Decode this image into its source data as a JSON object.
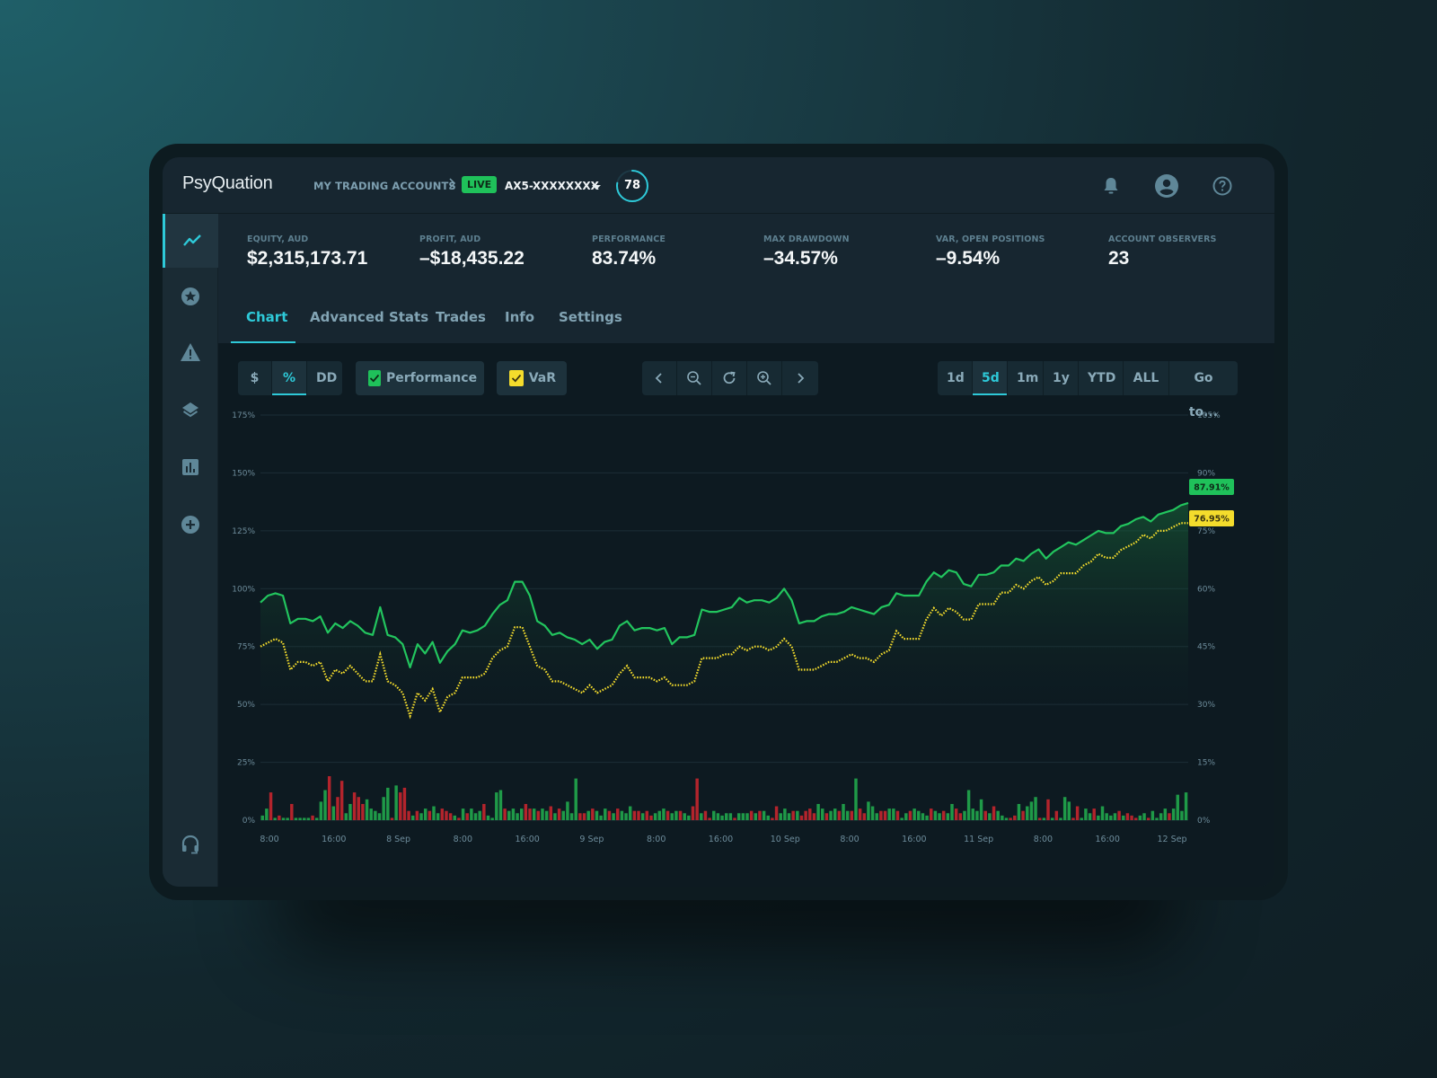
{
  "app": {
    "logo": "PsyQuation",
    "breadcrumb": "MY TRADING ACCOUNTS",
    "status_badge": "LIVE",
    "account": "AX5-XXXXXXXX",
    "score": "78",
    "score_fraction": 0.78
  },
  "sidebar": {
    "items": [
      {
        "icon": "trend-line-icon",
        "active": true
      },
      {
        "icon": "star-circle-icon",
        "active": false
      },
      {
        "icon": "warning-icon",
        "active": false
      },
      {
        "icon": "layers-icon",
        "active": false
      },
      {
        "icon": "bar-chart-icon",
        "active": false
      },
      {
        "icon": "plus-circle-icon",
        "active": false
      },
      {
        "icon": "headset-icon",
        "active": false
      }
    ]
  },
  "header_icons": [
    "bell-icon",
    "user-avatar-icon",
    "help-icon"
  ],
  "stats": [
    {
      "label": "EQUITY, AUD",
      "value": "$2,315,173.71"
    },
    {
      "label": "PROFIT, AUD",
      "value": "–$18,435.22"
    },
    {
      "label": "PERFORMANCE",
      "value": "83.74%"
    },
    {
      "label": "MAX DRAWDOWN",
      "value": "–34.57%"
    },
    {
      "label": "VAR, OPEN POSITIONS",
      "value": "–9.54%"
    },
    {
      "label": "ACCOUNT OBSERVERS",
      "value": "23"
    }
  ],
  "tabs": [
    {
      "label": "Chart",
      "active": true
    },
    {
      "label": "Advanced Stats",
      "active": false
    },
    {
      "label": "Trades",
      "active": false
    },
    {
      "label": "Info",
      "active": false
    },
    {
      "label": "Settings",
      "active": false
    }
  ],
  "toolbar": {
    "units": [
      {
        "label": "$",
        "active": false
      },
      {
        "label": "%",
        "active": true
      },
      {
        "label": "DD",
        "active": false
      }
    ],
    "toggles": [
      {
        "label": "Performance",
        "checked": true,
        "color": "#1fc15a"
      },
      {
        "label": "VaR",
        "checked": true,
        "color": "#f4dc2c"
      }
    ],
    "nav": [
      "chevron-left-icon",
      "zoom-out-icon",
      "refresh-icon",
      "zoom-in-icon",
      "chevron-right-icon"
    ],
    "ranges": [
      {
        "label": "1d",
        "active": false
      },
      {
        "label": "5d",
        "active": true
      },
      {
        "label": "1m",
        "active": false
      },
      {
        "label": "1y",
        "active": false
      },
      {
        "label": "YTD",
        "active": false
      },
      {
        "label": "ALL",
        "active": false
      },
      {
        "label": "Go to...",
        "active": false
      }
    ]
  },
  "chart_data": {
    "type": "line",
    "left_axis": {
      "ticks": [
        "175%",
        "150%",
        "125%",
        "100%",
        "75%",
        "50%",
        "25%",
        "0%"
      ],
      "range": [
        0,
        175
      ]
    },
    "right_axis": {
      "ticks": [
        "105%",
        "90%",
        "75%",
        "60%",
        "45%",
        "30%",
        "15%",
        "0%"
      ],
      "range": [
        0,
        105
      ]
    },
    "x_ticks": [
      "8:00",
      "16:00",
      "8 Sep",
      "8:00",
      "16:00",
      "9 Sep",
      "8:00",
      "16:00",
      "10 Sep",
      "8:00",
      "16:00",
      "11 Sep",
      "8:00",
      "16:00",
      "12 Sep"
    ],
    "grid": true,
    "series": [
      {
        "name": "Performance",
        "axis": "left",
        "color": "#22c55e",
        "style": "solid",
        "last_label": "87.91%",
        "values": [
          94,
          97,
          98,
          97,
          85,
          87,
          87,
          86,
          88,
          81,
          85,
          83,
          86,
          84,
          81,
          80,
          92,
          80,
          79,
          76,
          66,
          76,
          72,
          77,
          68,
          73,
          76,
          82,
          81,
          82,
          84,
          89,
          93,
          95,
          103,
          103,
          97,
          86,
          84,
          80,
          81,
          79,
          78,
          76,
          78,
          74,
          77,
          78,
          84,
          86,
          82,
          83,
          83,
          82,
          83,
          76,
          79,
          79,
          80,
          91,
          90,
          90,
          91,
          92,
          96,
          94,
          95,
          95,
          94,
          96,
          100,
          95,
          85,
          86,
          86,
          88,
          89,
          89,
          90,
          92,
          91,
          90,
          89,
          92,
          93,
          98,
          97,
          97,
          97,
          103,
          107,
          105,
          108,
          107,
          102,
          101,
          106,
          106,
          107,
          110,
          110,
          113,
          112,
          115,
          117,
          113,
          116,
          118,
          120,
          119,
          121,
          123,
          125,
          124,
          124,
          127,
          128,
          130,
          131,
          129,
          132,
          133,
          134,
          136,
          137
        ]
      },
      {
        "name": "VaR",
        "axis": "right",
        "color": "#f4dc2c",
        "style": "dotted",
        "last_label": "76.95%",
        "values": [
          45,
          46,
          47,
          46,
          39,
          41,
          41,
          40,
          41,
          36,
          39,
          38,
          40,
          38,
          36,
          36,
          43,
          36,
          35,
          33,
          27,
          33,
          31,
          34,
          28,
          32,
          33,
          37,
          37,
          37,
          38,
          42,
          44,
          45,
          50,
          50,
          45,
          40,
          39,
          36,
          36,
          35,
          34,
          33,
          35,
          33,
          34,
          35,
          38,
          40,
          37,
          37,
          37,
          36,
          37,
          35,
          35,
          35,
          36,
          42,
          42,
          42,
          43,
          43,
          45,
          44,
          45,
          45,
          44,
          45,
          47,
          45,
          39,
          39,
          39,
          40,
          41,
          41,
          42,
          43,
          42,
          42,
          41,
          43,
          44,
          49,
          47,
          47,
          47,
          52,
          55,
          53,
          55,
          54,
          52,
          52,
          56,
          56,
          56,
          59,
          59,
          61,
          60,
          62,
          63,
          61,
          62,
          64,
          64,
          64,
          66,
          67,
          69,
          68,
          68,
          70,
          71,
          72,
          74,
          73,
          75,
          75,
          76,
          77,
          77
        ]
      }
    ],
    "volume": {
      "axis": "left",
      "values": [
        2,
        5,
        12,
        1,
        2,
        1,
        1,
        7,
        1,
        1,
        1,
        1,
        2,
        1,
        8,
        13,
        19,
        6,
        10,
        17,
        3,
        7,
        12,
        10,
        7,
        9,
        5,
        4,
        3,
        10,
        14,
        1,
        15,
        12,
        14,
        4,
        2,
        4,
        3,
        5,
        4,
        6,
        3,
        5,
        4,
        3,
        2,
        1,
        5,
        3,
        5,
        3,
        4,
        7,
        2,
        1,
        12,
        13,
        5,
        4,
        5,
        3,
        5,
        7,
        5,
        5,
        4,
        5,
        4,
        6,
        3,
        5,
        4,
        8,
        3,
        18,
        3,
        3,
        4,
        5,
        4,
        2,
        5,
        4,
        3,
        5,
        4,
        3,
        6,
        4,
        4,
        3,
        4,
        2,
        3,
        4,
        5,
        4,
        3,
        4,
        4,
        3,
        2,
        6,
        18,
        3,
        4,
        1,
        4,
        3,
        2,
        3,
        3,
        1,
        3,
        3,
        3,
        4,
        3,
        4,
        4,
        2,
        1,
        6,
        3,
        5,
        3,
        4,
        4,
        2,
        4,
        5,
        3,
        7,
        5,
        3,
        4,
        5,
        4,
        7,
        4,
        4,
        18,
        5,
        3,
        8,
        6,
        3,
        4,
        4,
        5,
        5,
        4,
        1,
        3,
        4,
        5,
        4,
        3,
        2,
        5,
        4,
        3,
        4,
        3,
        7,
        5,
        3,
        4,
        13,
        5,
        4,
        9,
        4,
        3,
        6,
        4,
        2,
        1,
        1,
        2,
        7,
        4,
        6,
        8,
        10,
        1,
        1,
        9,
        1,
        4,
        1,
        10,
        8,
        1,
        6,
        1,
        5,
        3,
        5,
        2,
        6,
        3,
        2,
        3,
        4,
        2,
        3,
        2,
        1,
        2,
        3,
        1,
        4,
        1,
        3,
        5,
        3,
        5,
        11,
        4,
        12
      ],
      "up_color": "#1f9a48",
      "down_color": "#b3242c",
      "down_flags": [
        0,
        0,
        1,
        0,
        1,
        0,
        0,
        1,
        0,
        0,
        0,
        0,
        1,
        0,
        0,
        0,
        1,
        0,
        1,
        1,
        0,
        0,
        1,
        1,
        1,
        0,
        0,
        0,
        0,
        0,
        0,
        1,
        0,
        1,
        1,
        1,
        0,
        1,
        0,
        0,
        1,
        0,
        0,
        1,
        1,
        1,
        0,
        1,
        0,
        1,
        0,
        0,
        0,
        1,
        0,
        0,
        0,
        0,
        1,
        0,
        0,
        0,
        0,
        1,
        1,
        0,
        1,
        0,
        0,
        1,
        0,
        1,
        0,
        0,
        0,
        0,
        1,
        1,
        0,
        1,
        0,
        0,
        0,
        1,
        0,
        1,
        0,
        0,
        0,
        1,
        1,
        0,
        1,
        1,
        0,
        0,
        0,
        1,
        0,
        0,
        1,
        0,
        0,
        1,
        1,
        0,
        1,
        1,
        0,
        0,
        0,
        0,
        0,
        1,
        0,
        0,
        0,
        1,
        0,
        1,
        0,
        0,
        1,
        1,
        0,
        0,
        0,
        1,
        0,
        1,
        1,
        1,
        1,
        0,
        0,
        1,
        0,
        0,
        1,
        0,
        0,
        1,
        0,
        1,
        1,
        0,
        0,
        0,
        1,
        1,
        0,
        0,
        1,
        0,
        0,
        1,
        0,
        0,
        0,
        0,
        1,
        0,
        0,
        1,
        0,
        0,
        1,
        1,
        0,
        0,
        0,
        0,
        0,
        1,
        0,
        1,
        0,
        0,
        0,
        1,
        1,
        0,
        1,
        0,
        0,
        0,
        1,
        0,
        1,
        0,
        1,
        0,
        0,
        0,
        1,
        1,
        0,
        0,
        0,
        1,
        0,
        0,
        0,
        0,
        0,
        1,
        0,
        1,
        1,
        1,
        0,
        0,
        1,
        0,
        0,
        0,
        0,
        1,
        0,
        0
      ]
    }
  }
}
